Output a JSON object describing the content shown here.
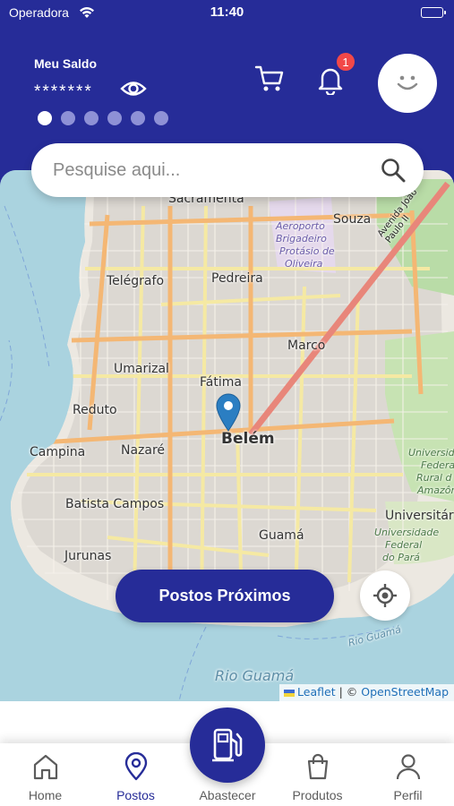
{
  "status_bar": {
    "carrier": "Operadora",
    "time": "11:40"
  },
  "header": {
    "balance_title": "Meu Saldo",
    "balance_value": "*******",
    "notification_count": "1",
    "carousel": {
      "total": 6,
      "active": 1
    }
  },
  "search": {
    "placeholder": "Pesquise aqui..."
  },
  "map": {
    "labels": {
      "sacramenta": "Sacramenta",
      "souza": "Souza",
      "airport_1": "Aeroporto",
      "airport_2": "Brigadeiro",
      "airport_3": "Protásio de",
      "airport_4": "Oliveira",
      "avenue": "Avenida João Paulo II",
      "telegrafo": "Telégrafo",
      "pedreira": "Pedreira",
      "marco": "Marco",
      "umarizal": "Umarizal",
      "fatima": "Fátima",
      "reduto": "Reduto",
      "belem": "Belém",
      "campina": "Campina",
      "nazare": "Nazaré",
      "univ_1": "Universid",
      "univ_2": "Federa",
      "univ_3": "Rural d",
      "univ_4": "Amazôn",
      "universitario": "Universitár",
      "ufpa_1": "Universidade",
      "ufpa_2": "Federal",
      "ufpa_3": "do Pará",
      "batista": "Batista Campos",
      "guama": "Guamá",
      "jurunas": "Jurunas",
      "rio_guama_small": "Rio Guamá",
      "rio_guama": "Rio Guamá"
    },
    "attribution": {
      "leaflet": "Leaflet",
      "separator": "| ©",
      "osm": "OpenStreetMap"
    }
  },
  "actions": {
    "nearby_button": "Postos Próximos"
  },
  "bottom_nav": {
    "items": [
      {
        "label": "Home",
        "icon": "home-icon"
      },
      {
        "label": "Postos",
        "icon": "map-pin-icon",
        "active": true
      },
      {
        "label": "Abastecer",
        "icon": "fuel-pump-icon"
      },
      {
        "label": "Produtos",
        "icon": "shopping-bag-icon"
      },
      {
        "label": "Perfil",
        "icon": "user-icon"
      }
    ]
  },
  "colors": {
    "primary": "#262c98",
    "badge": "#f24848",
    "water": "#aad3df"
  }
}
